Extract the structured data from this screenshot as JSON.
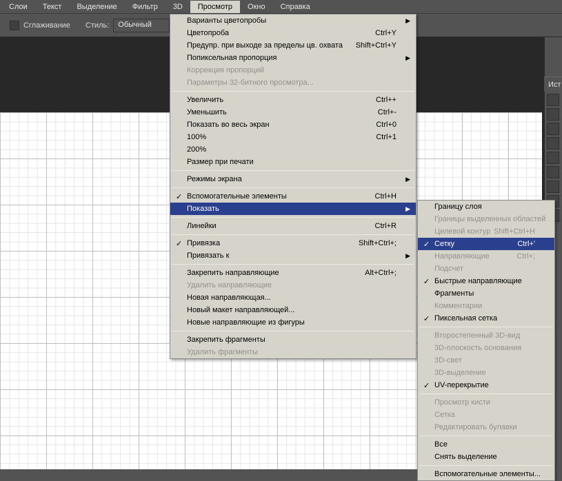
{
  "menubar": {
    "items": [
      "Слои",
      "Текст",
      "Выделение",
      "Фильтр",
      "3D",
      "Просмотр",
      "Окно",
      "Справка"
    ],
    "active_index": 5
  },
  "options_bar": {
    "smoothing_label": "Сглаживание",
    "style_label": "Стиль:",
    "style_value": "Обычный"
  },
  "side_tab_label": "Ист",
  "dropdown_main": [
    {
      "type": "item",
      "label": "Варианты цветопробы",
      "arrow": true
    },
    {
      "type": "item",
      "label": "Цветопроба",
      "shortcut": "Ctrl+Y"
    },
    {
      "type": "item",
      "label": "Предупр. при выходе за пределы цв. охвата",
      "shortcut": "Shift+Ctrl+Y"
    },
    {
      "type": "item",
      "label": "Попиксельная пропорция",
      "arrow": true
    },
    {
      "type": "item",
      "label": "Коррекция пропорций",
      "disabled": true
    },
    {
      "type": "item",
      "label": "Параметры 32-битного просмотра...",
      "disabled": true
    },
    {
      "type": "sep"
    },
    {
      "type": "item",
      "label": "Увеличить",
      "shortcut": "Ctrl++"
    },
    {
      "type": "item",
      "label": "Уменьшить",
      "shortcut": "Ctrl+-"
    },
    {
      "type": "item",
      "label": "Показать во весь экран",
      "shortcut": "Ctrl+0"
    },
    {
      "type": "item",
      "label": "100%",
      "shortcut": "Ctrl+1"
    },
    {
      "type": "item",
      "label": "200%"
    },
    {
      "type": "item",
      "label": "Размер при печати"
    },
    {
      "type": "sep"
    },
    {
      "type": "item",
      "label": "Режимы экрана",
      "arrow": true
    },
    {
      "type": "sep"
    },
    {
      "type": "item",
      "label": "Вспомогательные элементы",
      "shortcut": "Ctrl+H",
      "checked": true
    },
    {
      "type": "item",
      "label": "Показать",
      "arrow": true,
      "hl": true
    },
    {
      "type": "sep"
    },
    {
      "type": "item",
      "label": "Линейки",
      "shortcut": "Ctrl+R"
    },
    {
      "type": "sep"
    },
    {
      "type": "item",
      "label": "Привязка",
      "shortcut": "Shift+Ctrl+;",
      "checked": true
    },
    {
      "type": "item",
      "label": "Привязать к",
      "arrow": true
    },
    {
      "type": "sep"
    },
    {
      "type": "item",
      "label": "Закрепить направляющие",
      "shortcut": "Alt+Ctrl+;"
    },
    {
      "type": "item",
      "label": "Удалить направляющие",
      "disabled": true
    },
    {
      "type": "item",
      "label": "Новая направляющая..."
    },
    {
      "type": "item",
      "label": "Новый макет направляющей..."
    },
    {
      "type": "item",
      "label": "Новые направляющие из фигуры"
    },
    {
      "type": "sep"
    },
    {
      "type": "item",
      "label": "Закрепить фрагменты"
    },
    {
      "type": "item",
      "label": "Удалить фрагменты",
      "disabled": true
    }
  ],
  "dropdown_sub": [
    {
      "type": "item",
      "label": "Границу слоя"
    },
    {
      "type": "item",
      "label": "Границы выделенных областей",
      "disabled": true
    },
    {
      "type": "item",
      "label": "Целевой контур",
      "shortcut": "Shift+Ctrl+H",
      "disabled": true
    },
    {
      "type": "item",
      "label": "Сетку",
      "shortcut": "Ctrl+'",
      "checked": true,
      "hl": true
    },
    {
      "type": "item",
      "label": "Направляющие",
      "shortcut": "Ctrl+;",
      "disabled": true
    },
    {
      "type": "item",
      "label": "Подсчет",
      "disabled": true
    },
    {
      "type": "item",
      "label": "Быстрые направляющие",
      "checked": true
    },
    {
      "type": "item",
      "label": "Фрагменты"
    },
    {
      "type": "item",
      "label": "Комментарии",
      "disabled": true
    },
    {
      "type": "item",
      "label": "Пиксельная сетка",
      "checked": true
    },
    {
      "type": "sep"
    },
    {
      "type": "item",
      "label": "Второстепенный 3D-вид",
      "disabled": true
    },
    {
      "type": "item",
      "label": "3D-плоскость основания",
      "disabled": true
    },
    {
      "type": "item",
      "label": "3D-свет",
      "disabled": true
    },
    {
      "type": "item",
      "label": "3D-выделение",
      "disabled": true
    },
    {
      "type": "item",
      "label": "UV-перекрытие",
      "checked": true
    },
    {
      "type": "sep"
    },
    {
      "type": "item",
      "label": "Просмотр кисти",
      "disabled": true
    },
    {
      "type": "item",
      "label": "Сетка",
      "disabled": true
    },
    {
      "type": "item",
      "label": "Редактировать булавки",
      "disabled": true
    },
    {
      "type": "sep"
    },
    {
      "type": "item",
      "label": "Все"
    },
    {
      "type": "item",
      "label": "Снять выделение"
    },
    {
      "type": "sep"
    },
    {
      "type": "item",
      "label": "Вспомогательные элементы..."
    }
  ]
}
